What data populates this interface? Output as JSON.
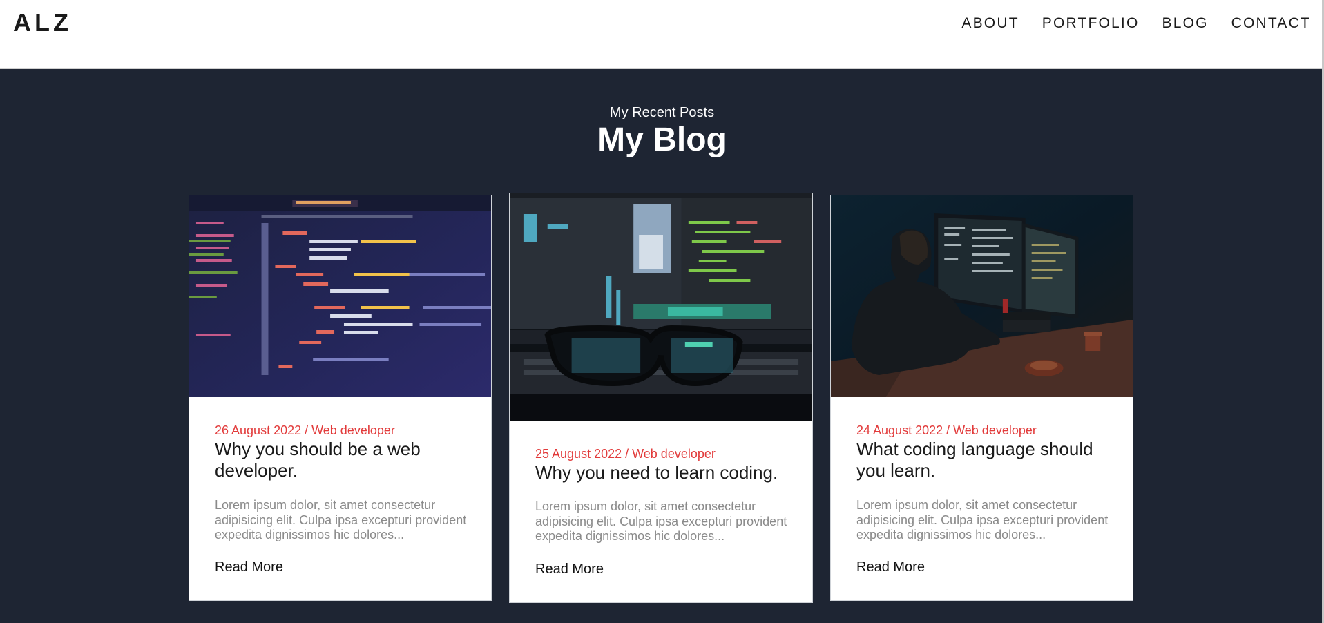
{
  "nav": {
    "logo": "ALZ",
    "links": [
      "ABOUT",
      "PORTFOLIO",
      "BLOG",
      "CONTACT"
    ]
  },
  "section": {
    "subtitle": "My Recent Posts",
    "title": "My Blog"
  },
  "posts": [
    {
      "image": "code-editor-screenshot",
      "meta": "26 August 2022 / Web developer",
      "title": "Why you should be a web developer.",
      "excerpt": "Lorem ipsum dolor, sit amet consectetur adipisicing elit. Culpa ipsa excepturi provident expedita dignissimos hic dolores...",
      "link": "Read More"
    },
    {
      "image": "monitor-and-glasses-photo",
      "meta": "25 August 2022 / Web developer",
      "title": "Why you need to learn coding.",
      "excerpt": "Lorem ipsum dolor, sit amet consectetur adipisicing elit. Culpa ipsa excepturi provident expedita dignissimos hic dolores...",
      "link": "Read More"
    },
    {
      "image": "developer-at-desk-photo",
      "meta": "24 August 2022 / Web developer",
      "title": "What coding language should you learn.",
      "excerpt": "Lorem ipsum dolor, sit amet consectetur adipisicing elit. Culpa ipsa excepturi provident expedita dignissimos hic dolores...",
      "link": "Read More"
    }
  ],
  "colors": {
    "background": "#1e2533",
    "accent": "#e23b3b",
    "card": "#ffffff"
  }
}
